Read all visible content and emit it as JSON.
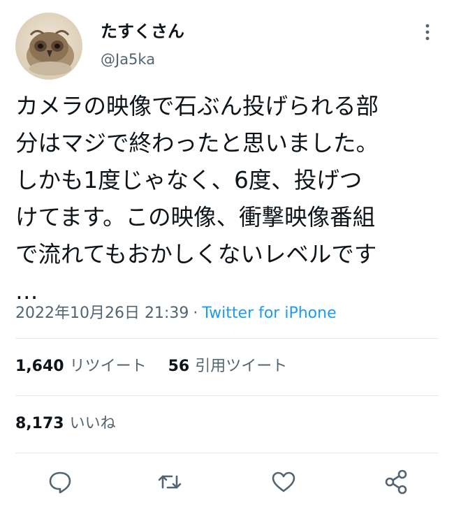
{
  "user": {
    "display_name": "たすくさん",
    "handle": "@Ja5ka",
    "avatar_icon": "owl-photo-avatar"
  },
  "menu": {
    "icon": "more-vertical-icon"
  },
  "tweet": {
    "lines": [
      "カメラの映像で石ぶん投げられる部",
      "分はマジで終わったと思いました。",
      "しかも1度じゃなく、6度、投げつ",
      "けてます。この映像、衝撃映像番組",
      "で流れてもおかしくないレベルです",
      "…"
    ],
    "timestamp": "2022年10月26日 21:39",
    "separator": "·",
    "source": "Twitter for iPhone"
  },
  "stats": {
    "retweets_count": "1,640",
    "retweets_label": "リツイート",
    "quotes_count": "56",
    "quotes_label": "引用ツイート",
    "likes_count": "8,173",
    "likes_label": "いいね"
  },
  "actions": {
    "reply_icon": "reply-icon",
    "retweet_icon": "retweet-icon",
    "like_icon": "like-icon",
    "share_icon": "share-icon"
  },
  "colors": {
    "text": "#0f1419",
    "secondary": "#536471",
    "link": "#1d9bf0",
    "divider": "#e6e9eb"
  }
}
